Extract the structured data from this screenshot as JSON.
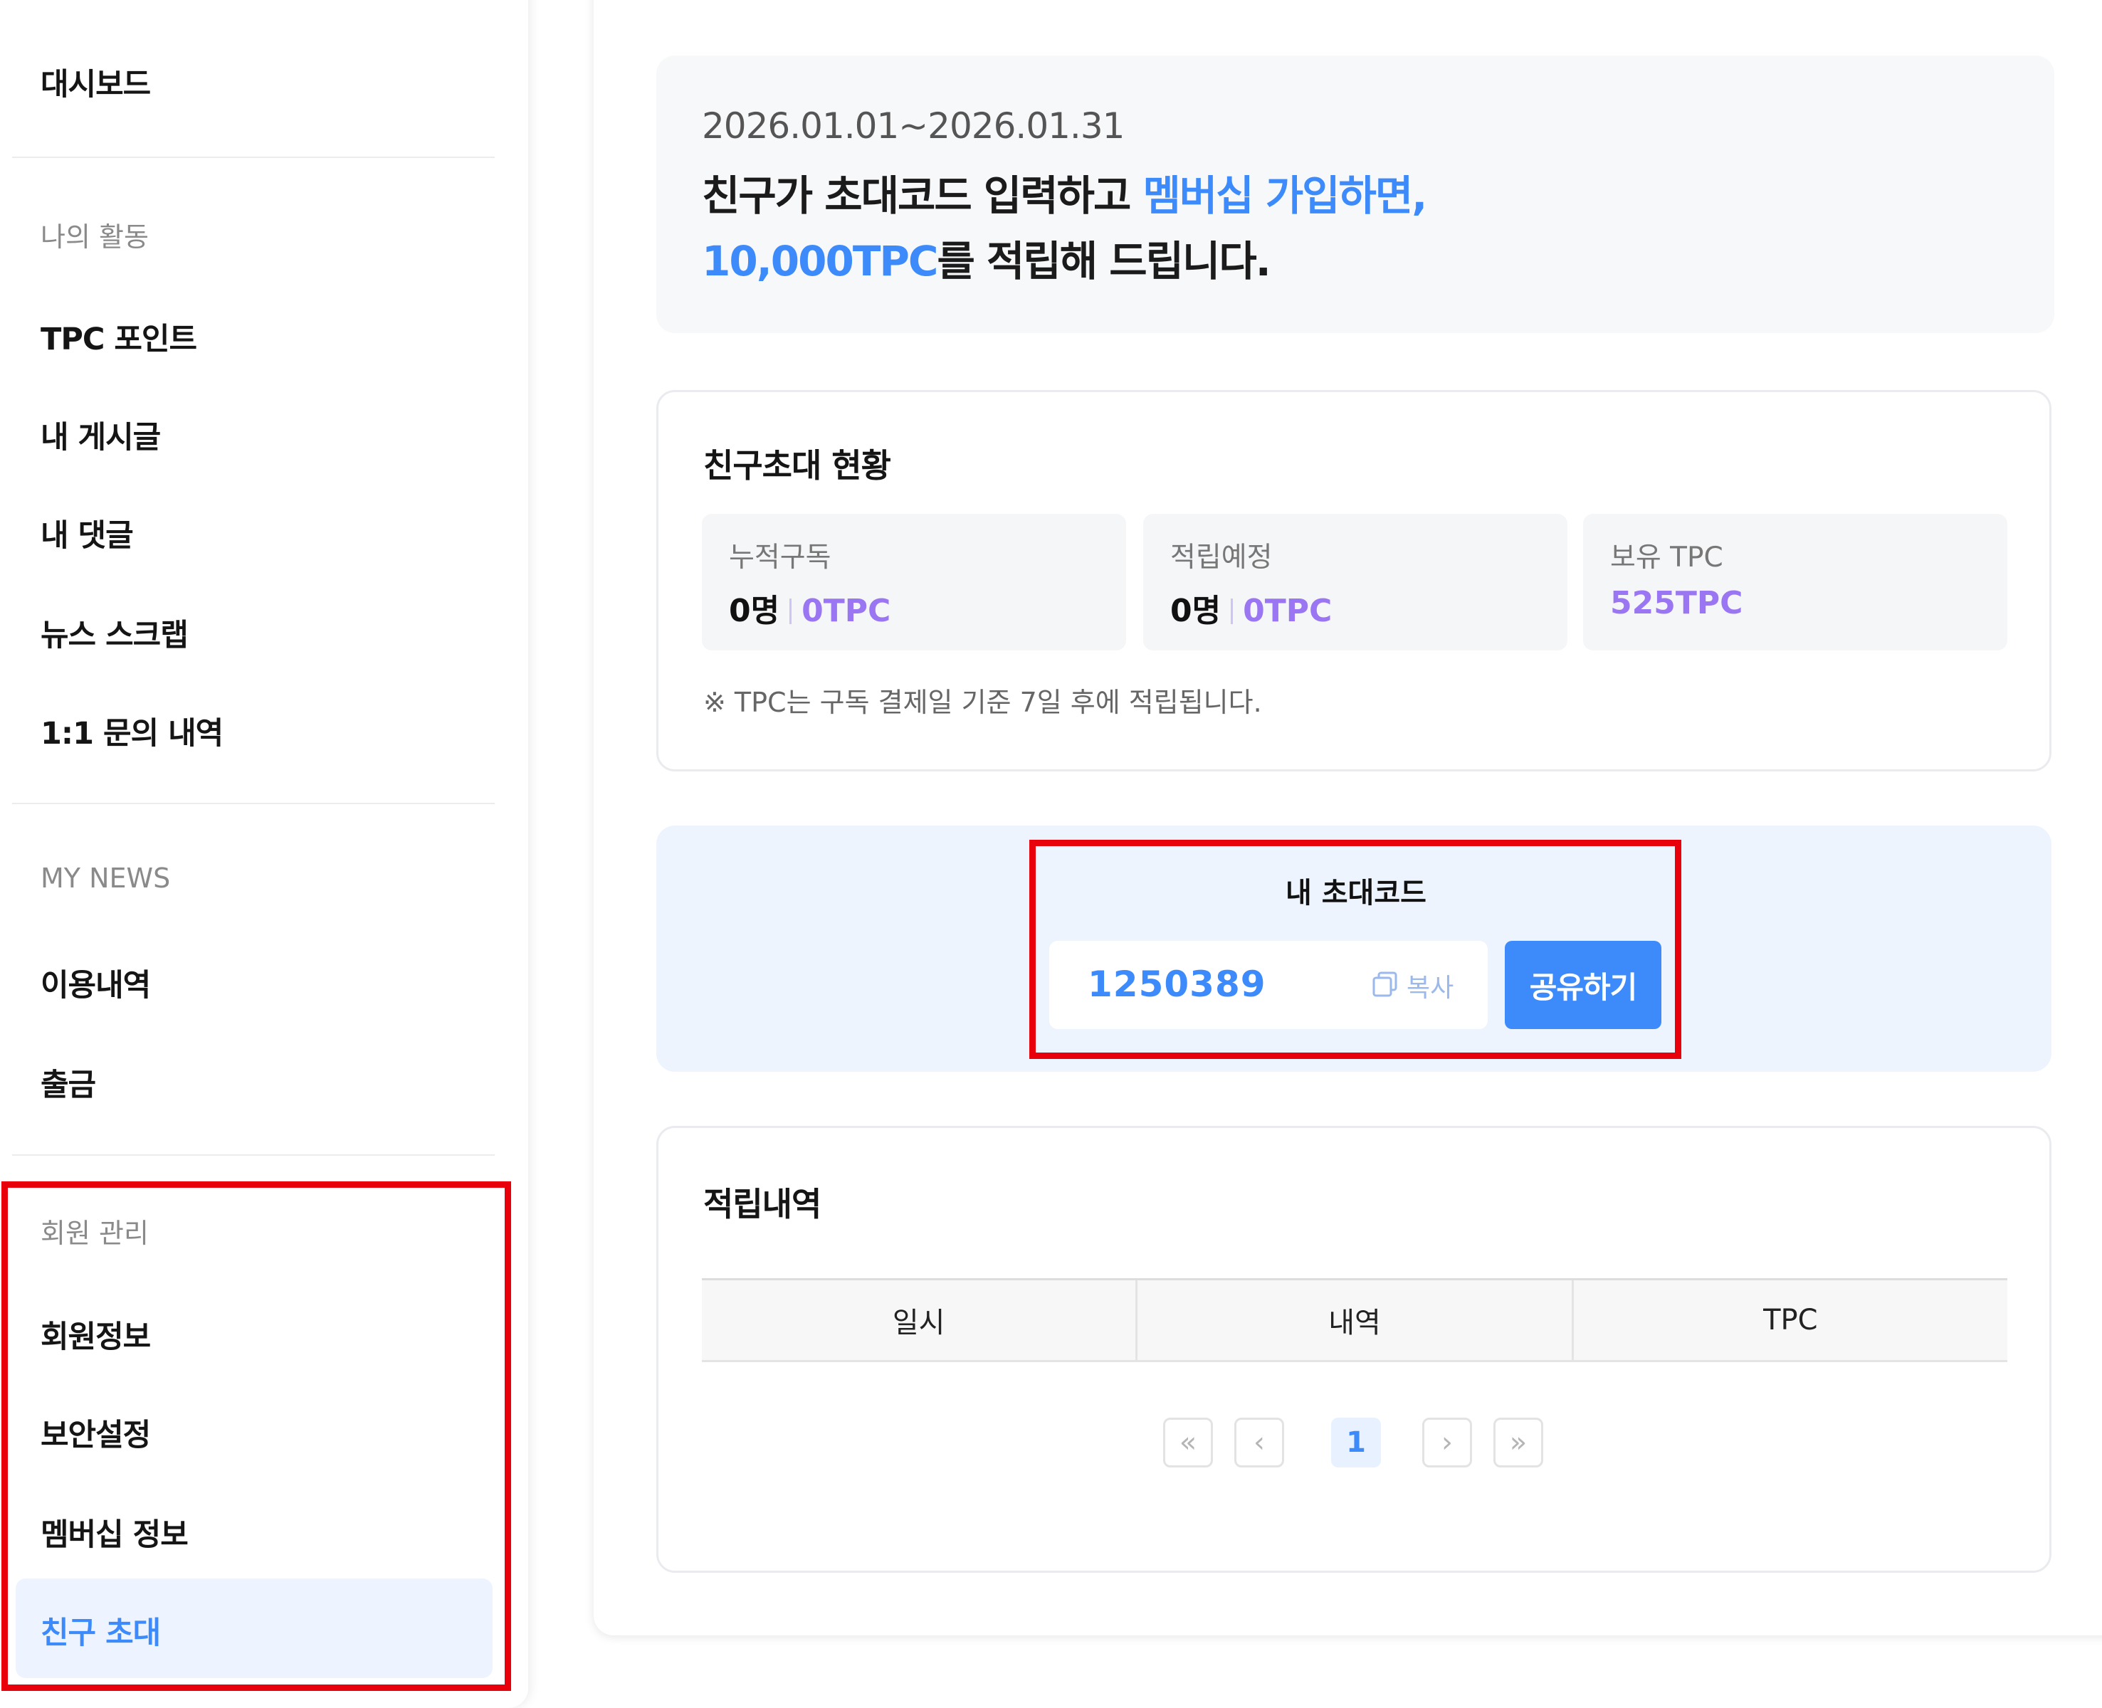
{
  "sidebar": {
    "dashboard": "대시보드",
    "section_activity": "나의 활동",
    "activity_items": [
      "TPC 포인트",
      "내 게시글",
      "내 댓글",
      "뉴스 스크랩",
      "1:1 문의 내역"
    ],
    "section_mynews": "MY NEWS",
    "mynews_items": [
      "이용내역",
      "출금"
    ],
    "section_member": "회원 관리",
    "member_items": [
      "회원정보",
      "보안설정",
      "멤버십 정보",
      "친구 초대"
    ]
  },
  "banner": {
    "date_range": "2026.01.01~2026.01.31",
    "line1_text": "친구가 초대코드 입력하고 ",
    "line1_highlight": "멤버십 가입하면,",
    "line2_highlight": "10,000TPC",
    "line2_text": "를 적립해 드립니다."
  },
  "status": {
    "title": "친구초대 현황",
    "cards": [
      {
        "label": "누적구독",
        "count": "0명",
        "tpc": "0TPC"
      },
      {
        "label": "적립예정",
        "count": "0명",
        "tpc": "0TPC"
      },
      {
        "label": "보유 TPC",
        "tpc": "525TPC"
      }
    ],
    "note": "※ TPC는 구독 결제일 기준 7일 후에 적립됩니다."
  },
  "invite": {
    "title": "내 초대코드",
    "code": "1250389",
    "copy_label": "복사",
    "share_label": "공유하기"
  },
  "history": {
    "title": "적립내역",
    "columns": [
      "일시",
      "내역",
      "TPC"
    ]
  },
  "pagination": {
    "first": "«",
    "prev": "‹",
    "current": "1",
    "next": "›",
    "last": "»"
  },
  "colors": {
    "accent_blue": "#3d8bfa",
    "tpc_purple": "#9a76f2",
    "highlight_red": "#e8000b"
  },
  "icons": [
    "copy-icon"
  ]
}
